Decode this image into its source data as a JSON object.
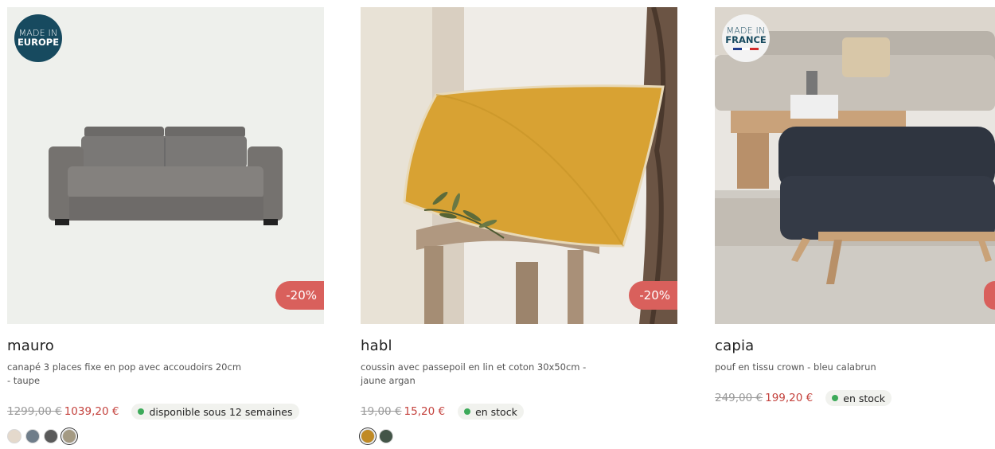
{
  "products": [
    {
      "name": "mauro",
      "description": "canapé 3 places fixe en pop avec accoudoirs 20cm - taupe",
      "badge": {
        "line1": "MADE IN",
        "line2": "EUROPE"
      },
      "discount": "-20%",
      "old_price": "1299,00 €",
      "new_price": "1039,20 €",
      "availability": "disponible sous 12 semaines",
      "swatch_colors": [
        "#e4d9cc",
        "#6f7d8a",
        "#5a5a5a",
        "#a49a83"
      ]
    },
    {
      "name": "habl",
      "description": "coussin avec passepoil en lin et coton 30x50cm - jaune argan",
      "discount": "-20%",
      "old_price": "19,00 €",
      "new_price": "15,20 €",
      "availability": "en stock",
      "swatch_colors": [
        "#c08a25",
        "#435548"
      ]
    },
    {
      "name": "capia",
      "description": "pouf en tissu crown - bleu calabrun",
      "badge": {
        "line1": "MADE IN",
        "line2": "FRANCE"
      },
      "old_price": "249,00 €",
      "new_price": "199,20 €",
      "availability": "en stock"
    }
  ],
  "colors": {
    "price_new": "#c4423d",
    "discount_badge": "#d9605c",
    "stock_dot": "#3daa5a",
    "made_in_europe_bg": "#174a5f"
  }
}
